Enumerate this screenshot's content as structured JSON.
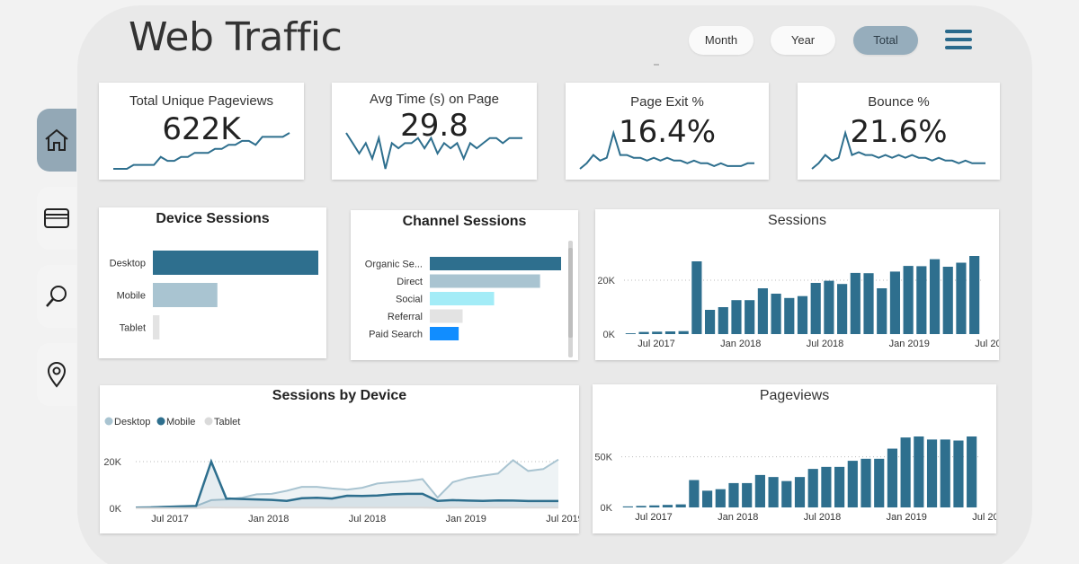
{
  "header": {
    "title": "Web Traffic",
    "filters": [
      {
        "label": "Month",
        "active": false
      },
      {
        "label": "Year",
        "active": false
      },
      {
        "label": "Total",
        "active": true
      }
    ]
  },
  "nav": [
    {
      "name": "home-icon",
      "active": true
    },
    {
      "name": "browser-window-icon",
      "active": false
    },
    {
      "name": "search-icon",
      "active": false
    },
    {
      "name": "location-pin-icon",
      "active": false
    }
  ],
  "kpis": [
    {
      "label": "Total Unique Pageviews",
      "value": "622K",
      "spark": [
        2,
        2,
        2,
        3,
        3,
        3,
        3,
        5,
        4,
        4,
        5,
        5,
        6,
        6,
        6,
        7,
        7,
        8,
        8,
        9,
        9,
        8,
        10,
        10,
        10,
        10,
        11
      ]
    },
    {
      "label": "Avg Time (s) on Page",
      "value": "29.8",
      "spark": [
        8,
        6,
        4,
        6,
        3,
        7,
        1,
        6,
        5,
        6,
        6,
        7,
        5,
        7,
        4,
        6,
        5,
        6,
        3,
        6,
        5,
        6,
        7,
        7,
        6,
        7,
        7,
        7
      ]
    },
    {
      "label": "Page Exit %",
      "value": "16.4%",
      "spark": [
        1,
        3,
        6,
        4,
        5,
        14,
        6,
        6,
        5,
        5,
        4,
        5,
        4,
        5,
        4,
        4,
        3,
        4,
        3,
        3,
        2,
        3,
        2,
        2,
        2,
        3,
        3
      ]
    },
    {
      "label": "Bounce %",
      "value": "21.6%",
      "spark": [
        1,
        3,
        6,
        4,
        5,
        14,
        6,
        7,
        6,
        6,
        5,
        6,
        5,
        6,
        5,
        6,
        5,
        5,
        4,
        5,
        4,
        4,
        3,
        4,
        3,
        3,
        3
      ]
    }
  ],
  "colors": {
    "primary": "#2e6f8e",
    "light": "#a9c4d1",
    "cyan": "#a3ecf7",
    "grey": "#e0e0e0",
    "blue": "#118dff",
    "tablet": "#dadada"
  },
  "device_sessions": {
    "title": "Device Sessions",
    "chart_data": {
      "type": "bar",
      "orientation": "horizontal",
      "categories": [
        "Desktop",
        "Mobile",
        "Tablet"
      ],
      "values": [
        100,
        39,
        4
      ],
      "colors": [
        "#2e6f8e",
        "#a9c4d1",
        "#e3e3e3"
      ]
    }
  },
  "channel_sessions": {
    "title": "Channel Sessions",
    "chart_data": {
      "type": "bar",
      "orientation": "horizontal",
      "categories": [
        "Organic Se...",
        "Direct",
        "Social",
        "Referral",
        "Paid Search"
      ],
      "values": [
        100,
        84,
        49,
        25,
        22
      ],
      "colors": [
        "#2e6f8e",
        "#a9c4d1",
        "#a3ecf7",
        "#e3e3e3",
        "#118dff"
      ]
    }
  },
  "sessions": {
    "title": "Sessions",
    "chart_data": {
      "type": "bar",
      "x_labels": [
        "Jul 2017",
        "Jan 2018",
        "Jul 2018",
        "Jan 2019",
        "Jul 2019"
      ],
      "y_ticks": [
        "20K",
        "0K"
      ],
      "ylim": [
        0,
        30000
      ],
      "values": [
        300,
        800,
        900,
        1000,
        1100,
        27000,
        9000,
        10000,
        12600,
        12600,
        17000,
        15000,
        13400,
        14100,
        19000,
        19800,
        18600,
        22700,
        22600,
        17000,
        23200,
        25300,
        25200,
        27800,
        25000,
        26500,
        29000
      ]
    }
  },
  "sessions_by_device": {
    "title": "Sessions by Device",
    "legend": [
      "Desktop",
      "Mobile",
      "Tablet"
    ],
    "chart_data": {
      "type": "area",
      "x_labels": [
        "Jul 2017",
        "Jan 2018",
        "Jul 2018",
        "Jan 2019",
        "Jul 2019"
      ],
      "y_ticks": [
        "20K",
        "0K"
      ],
      "ylim": [
        0,
        25000
      ],
      "series": [
        {
          "name": "Desktop",
          "values": [
            300,
            500,
            700,
            900,
            1000,
            3500,
            3800,
            4500,
            6000,
            6200,
            7500,
            9200,
            9200,
            8500,
            8000,
            8800,
            10600,
            11200,
            11600,
            12500,
            4600,
            11200,
            13000,
            14000,
            14900,
            20600,
            16000,
            16800,
            20900
          ]
        },
        {
          "name": "Mobile",
          "values": [
            300,
            400,
            600,
            800,
            1000,
            20000,
            4200,
            4000,
            3800,
            3600,
            3200,
            4300,
            4500,
            4200,
            5400,
            5300,
            5500,
            6000,
            6200,
            6200,
            3200,
            3500,
            3300,
            3200,
            3400,
            3300,
            3100,
            3100,
            3100
          ]
        },
        {
          "name": "Tablet",
          "values": [
            100,
            100,
            100,
            100,
            100,
            400,
            300,
            300,
            300,
            300,
            300,
            300,
            300,
            300,
            300,
            300,
            300,
            300,
            300,
            300,
            200,
            300,
            300,
            300,
            300,
            300,
            300,
            300,
            300
          ]
        }
      ]
    }
  },
  "pageviews": {
    "title": "Pageviews",
    "chart_data": {
      "type": "bar",
      "x_labels": [
        "Jul 2017",
        "Jan 2018",
        "Jul 2018",
        "Jan 2019",
        "Jul 2019"
      ],
      "y_ticks": [
        "50K",
        "0K"
      ],
      "ylim": [
        0,
        70000
      ],
      "values": [
        1000,
        1500,
        2000,
        2500,
        3000,
        27000,
        16500,
        18000,
        24000,
        24000,
        32000,
        30000,
        26000,
        30000,
        38000,
        40000,
        40000,
        46000,
        48000,
        48000,
        58000,
        69000,
        70000,
        67000,
        67000,
        66000,
        75000
      ]
    }
  }
}
